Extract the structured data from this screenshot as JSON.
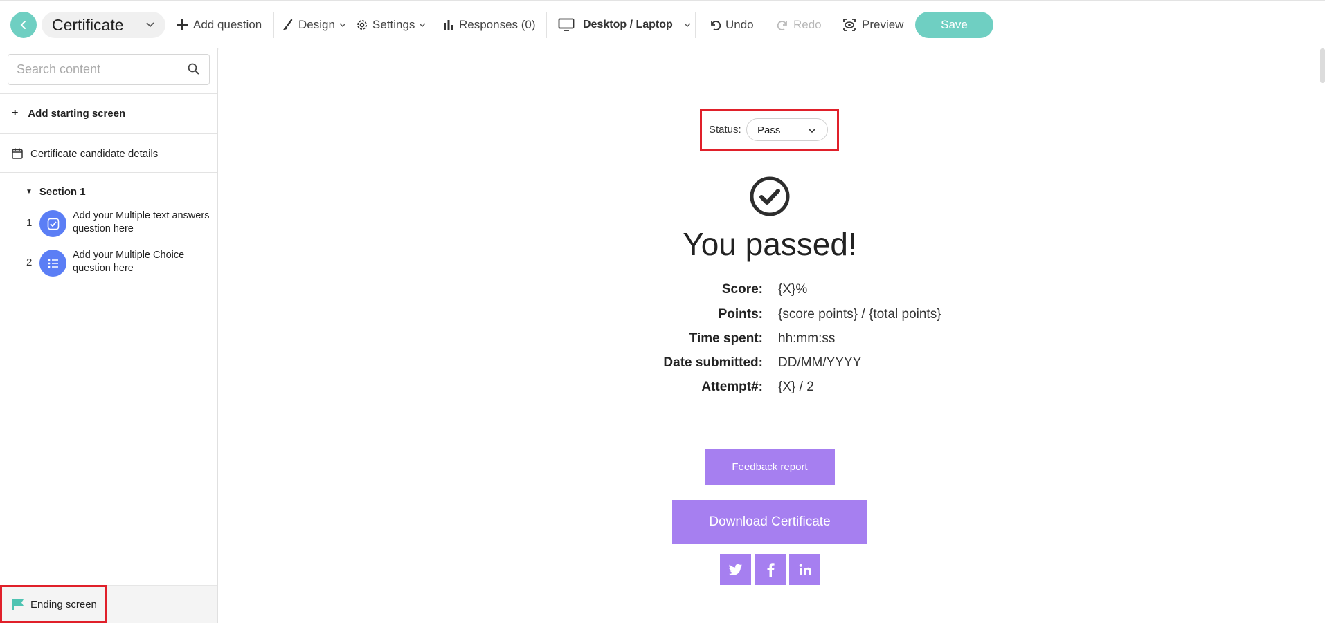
{
  "toolbar": {
    "title": "Certificate",
    "add_question": "Add question",
    "design": "Design",
    "settings": "Settings",
    "responses": "Responses (0)",
    "device": "Desktop / Laptop",
    "undo": "Undo",
    "redo": "Redo",
    "preview": "Preview",
    "save": "Save"
  },
  "sidebar": {
    "search_placeholder": "Search content",
    "add_starting_screen": "Add starting screen",
    "candidate_details": "Certificate candidate details",
    "section_label": "Section 1",
    "questions": [
      {
        "number": "1",
        "text": "Add your Multiple text answers question here",
        "icon": "checkbox-icon"
      },
      {
        "number": "2",
        "text": "Add your Multiple Choice question here",
        "icon": "list-icon"
      }
    ],
    "ending_screen": "Ending screen"
  },
  "main": {
    "status_label": "Status:",
    "status_value": "Pass",
    "headline": "You passed!",
    "stats": [
      {
        "label": "Score:",
        "value": "{X}%"
      },
      {
        "label": "Points:",
        "value": "{score points} / {total points}"
      },
      {
        "label": "Time spent:",
        "value": "hh:mm:ss"
      },
      {
        "label": "Date submitted:",
        "value": "DD/MM/YYYY"
      },
      {
        "label": "Attempt#:",
        "value": "{X} / 2"
      }
    ],
    "feedback_button": "Feedback report",
    "download_button": "Download Certificate",
    "social": [
      "twitter-icon",
      "facebook-icon",
      "linkedin-icon"
    ]
  },
  "colors": {
    "accent_teal": "#6fcfc2",
    "button_purple": "#a67ff0",
    "question_icon_blue": "#5b7ef5",
    "highlight_red": "#e0202a"
  }
}
